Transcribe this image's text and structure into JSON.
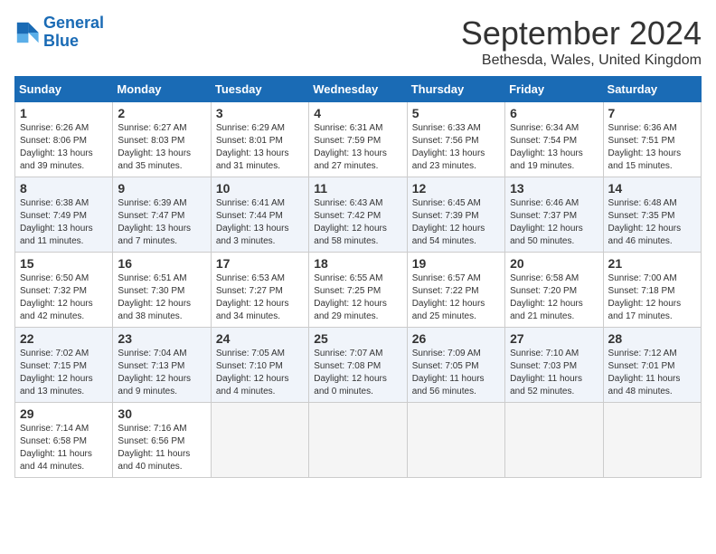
{
  "logo": {
    "line1": "General",
    "line2": "Blue"
  },
  "title": "September 2024",
  "location": "Bethesda, Wales, United Kingdom",
  "days_of_week": [
    "Sunday",
    "Monday",
    "Tuesday",
    "Wednesday",
    "Thursday",
    "Friday",
    "Saturday"
  ],
  "weeks": [
    [
      {
        "day": "1",
        "sunrise": "6:26 AM",
        "sunset": "8:06 PM",
        "daylight": "13 hours and 39 minutes."
      },
      {
        "day": "2",
        "sunrise": "6:27 AM",
        "sunset": "8:03 PM",
        "daylight": "13 hours and 35 minutes."
      },
      {
        "day": "3",
        "sunrise": "6:29 AM",
        "sunset": "8:01 PM",
        "daylight": "13 hours and 31 minutes."
      },
      {
        "day": "4",
        "sunrise": "6:31 AM",
        "sunset": "7:59 PM",
        "daylight": "13 hours and 27 minutes."
      },
      {
        "day": "5",
        "sunrise": "6:33 AM",
        "sunset": "7:56 PM",
        "daylight": "13 hours and 23 minutes."
      },
      {
        "day": "6",
        "sunrise": "6:34 AM",
        "sunset": "7:54 PM",
        "daylight": "13 hours and 19 minutes."
      },
      {
        "day": "7",
        "sunrise": "6:36 AM",
        "sunset": "7:51 PM",
        "daylight": "13 hours and 15 minutes."
      }
    ],
    [
      {
        "day": "8",
        "sunrise": "6:38 AM",
        "sunset": "7:49 PM",
        "daylight": "13 hours and 11 minutes."
      },
      {
        "day": "9",
        "sunrise": "6:39 AM",
        "sunset": "7:47 PM",
        "daylight": "13 hours and 7 minutes."
      },
      {
        "day": "10",
        "sunrise": "6:41 AM",
        "sunset": "7:44 PM",
        "daylight": "13 hours and 3 minutes."
      },
      {
        "day": "11",
        "sunrise": "6:43 AM",
        "sunset": "7:42 PM",
        "daylight": "12 hours and 58 minutes."
      },
      {
        "day": "12",
        "sunrise": "6:45 AM",
        "sunset": "7:39 PM",
        "daylight": "12 hours and 54 minutes."
      },
      {
        "day": "13",
        "sunrise": "6:46 AM",
        "sunset": "7:37 PM",
        "daylight": "12 hours and 50 minutes."
      },
      {
        "day": "14",
        "sunrise": "6:48 AM",
        "sunset": "7:35 PM",
        "daylight": "12 hours and 46 minutes."
      }
    ],
    [
      {
        "day": "15",
        "sunrise": "6:50 AM",
        "sunset": "7:32 PM",
        "daylight": "12 hours and 42 minutes."
      },
      {
        "day": "16",
        "sunrise": "6:51 AM",
        "sunset": "7:30 PM",
        "daylight": "12 hours and 38 minutes."
      },
      {
        "day": "17",
        "sunrise": "6:53 AM",
        "sunset": "7:27 PM",
        "daylight": "12 hours and 34 minutes."
      },
      {
        "day": "18",
        "sunrise": "6:55 AM",
        "sunset": "7:25 PM",
        "daylight": "12 hours and 29 minutes."
      },
      {
        "day": "19",
        "sunrise": "6:57 AM",
        "sunset": "7:22 PM",
        "daylight": "12 hours and 25 minutes."
      },
      {
        "day": "20",
        "sunrise": "6:58 AM",
        "sunset": "7:20 PM",
        "daylight": "12 hours and 21 minutes."
      },
      {
        "day": "21",
        "sunrise": "7:00 AM",
        "sunset": "7:18 PM",
        "daylight": "12 hours and 17 minutes."
      }
    ],
    [
      {
        "day": "22",
        "sunrise": "7:02 AM",
        "sunset": "7:15 PM",
        "daylight": "12 hours and 13 minutes."
      },
      {
        "day": "23",
        "sunrise": "7:04 AM",
        "sunset": "7:13 PM",
        "daylight": "12 hours and 9 minutes."
      },
      {
        "day": "24",
        "sunrise": "7:05 AM",
        "sunset": "7:10 PM",
        "daylight": "12 hours and 4 minutes."
      },
      {
        "day": "25",
        "sunrise": "7:07 AM",
        "sunset": "7:08 PM",
        "daylight": "12 hours and 0 minutes."
      },
      {
        "day": "26",
        "sunrise": "7:09 AM",
        "sunset": "7:05 PM",
        "daylight": "11 hours and 56 minutes."
      },
      {
        "day": "27",
        "sunrise": "7:10 AM",
        "sunset": "7:03 PM",
        "daylight": "11 hours and 52 minutes."
      },
      {
        "day": "28",
        "sunrise": "7:12 AM",
        "sunset": "7:01 PM",
        "daylight": "11 hours and 48 minutes."
      }
    ],
    [
      {
        "day": "29",
        "sunrise": "7:14 AM",
        "sunset": "6:58 PM",
        "daylight": "11 hours and 44 minutes."
      },
      {
        "day": "30",
        "sunrise": "7:16 AM",
        "sunset": "6:56 PM",
        "daylight": "11 hours and 40 minutes."
      },
      null,
      null,
      null,
      null,
      null
    ]
  ]
}
